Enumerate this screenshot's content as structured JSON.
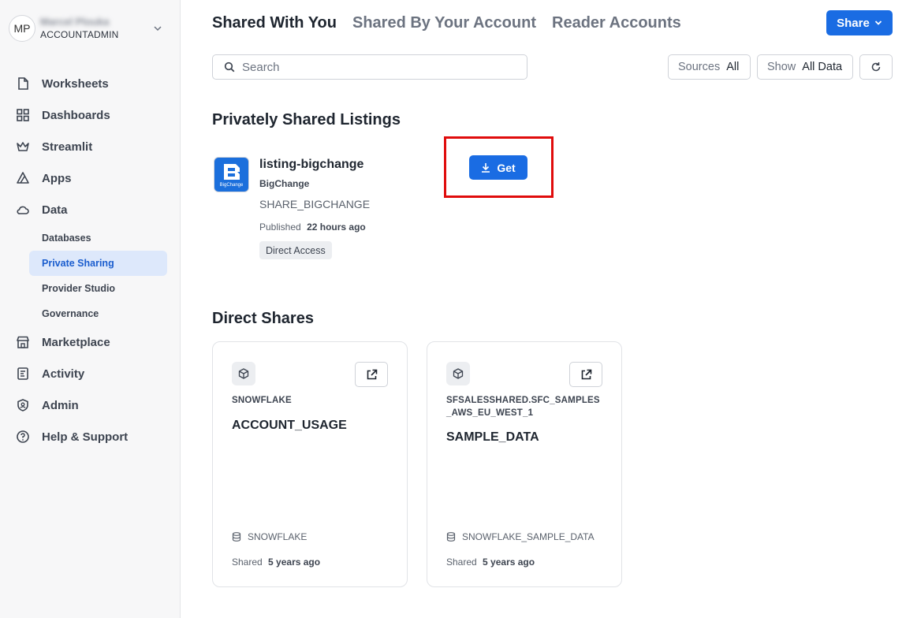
{
  "user": {
    "initials": "MP",
    "name": "Marcel Plouka",
    "role": "ACCOUNTADMIN"
  },
  "nav": {
    "worksheets": "Worksheets",
    "dashboards": "Dashboards",
    "streamlit": "Streamlit",
    "apps": "Apps",
    "data": "Data",
    "databases": "Databases",
    "private_sharing": "Private Sharing",
    "provider_studio": "Provider Studio",
    "governance": "Governance",
    "marketplace": "Marketplace",
    "activity": "Activity",
    "admin": "Admin",
    "help": "Help & Support"
  },
  "tabs": [
    "Shared With You",
    "Shared By Your Account",
    "Reader Accounts"
  ],
  "share_button": "Share",
  "search": {
    "placeholder": "Search"
  },
  "filters": {
    "sources_label": "Sources",
    "sources_value": "All",
    "show_label": "Show",
    "show_value": "All Data"
  },
  "privately_shared": {
    "title": "Privately Shared Listings",
    "listing": {
      "logo_text": "BigChange",
      "name": "listing-bigchange",
      "provider": "BigChange",
      "share_name": "SHARE_BIGCHANGE",
      "published_label": "Published",
      "published_value": "22 hours ago",
      "badge": "Direct Access",
      "get_label": "Get"
    }
  },
  "direct_shares": {
    "title": "Direct Shares",
    "cards": [
      {
        "database": "SNOWFLAKE",
        "schema": "ACCOUNT_USAGE",
        "source": "SNOWFLAKE",
        "shared_label": "Shared",
        "shared_value": "5 years ago"
      },
      {
        "database": "SFSALESSHARED.SFC_SAMPLES_AWS_EU_WEST_1",
        "schema": "SAMPLE_DATA",
        "source": "SNOWFLAKE_SAMPLE_DATA",
        "shared_label": "Shared",
        "shared_value": "5 years ago"
      }
    ]
  },
  "colors": {
    "accent": "#1a6ce3",
    "highlight": "#e00c0c",
    "active_nav_bg": "#dde8fb"
  }
}
